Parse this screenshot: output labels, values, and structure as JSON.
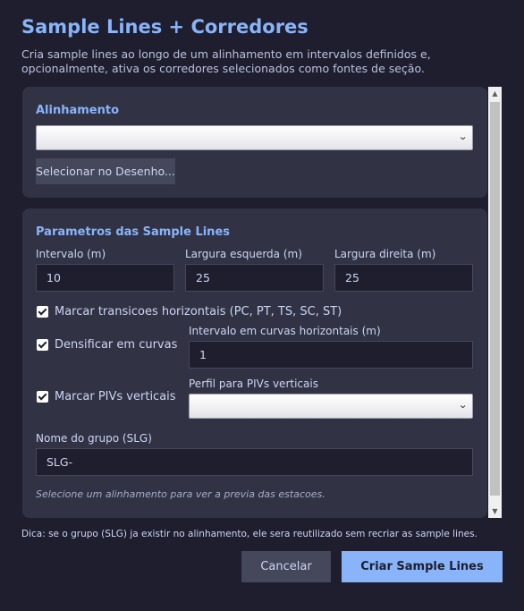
{
  "dialog": {
    "title": "Sample Lines + Corredores",
    "description": "Cria sample lines ao longo de um alinhamento em intervalos definidos e, opcionalmente, ativa os corredores selecionados como fontes de seção."
  },
  "alignment": {
    "section_title": "Alinhamento",
    "selected": "",
    "select_button": "Selecionar no Desenho..."
  },
  "params": {
    "section_title": "Parametros das Sample Lines",
    "interval_label": "Intervalo (m)",
    "interval_value": "10",
    "left_width_label": "Largura esquerda (m)",
    "left_width_value": "25",
    "right_width_label": "Largura direita (m)",
    "right_width_value": "25",
    "mark_transitions_label": "Marcar transicoes horizontais (PC, PT, TS, SC, ST)",
    "densify_label": "Densificar em curvas horizontais",
    "curve_interval_label": "Intervalo em curvas horizontais (m)",
    "curve_interval_value": "1",
    "mark_pivs_label": "Marcar PIVs verticais",
    "profile_label": "Perfil para PIVs verticais",
    "profile_selected": "",
    "group_label": "Nome do grupo (SLG)",
    "group_value": "SLG-",
    "preview_hint": "Selecione um alinhamento para ver a previa das estacoes."
  },
  "footer": {
    "tip": "Dica: se o grupo (SLG) ja existir no alinhamento, ele sera reutilizado sem recriar as sample lines.",
    "cancel": "Cancelar",
    "create": "Criar Sample Lines"
  }
}
